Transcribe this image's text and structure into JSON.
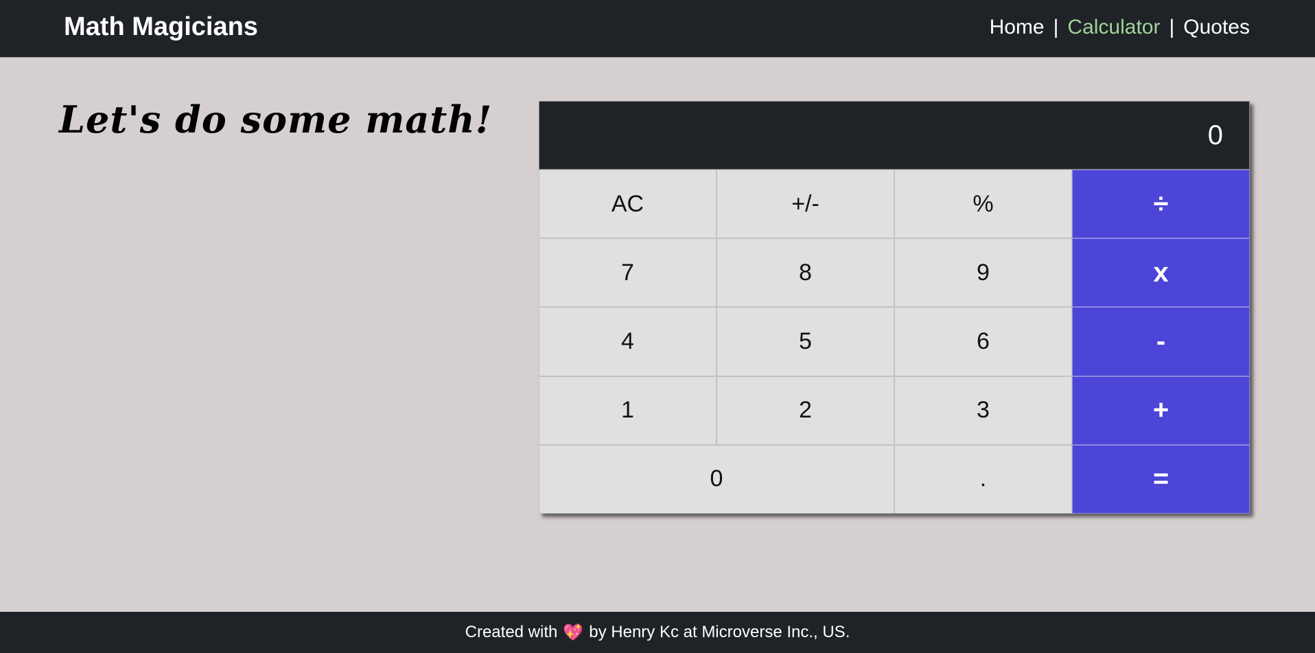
{
  "navbar": {
    "brand": "Math Magicians",
    "links": [
      {
        "label": "Home"
      },
      {
        "label": "Calculator"
      },
      {
        "label": "Quotes"
      }
    ],
    "separator": "|",
    "active_color": "#9fd49a"
  },
  "heading": "Let's do some math!",
  "calculator": {
    "display": "0",
    "keys": [
      {
        "label": "AC",
        "type": "function"
      },
      {
        "label": "+/-",
        "type": "function"
      },
      {
        "label": "%",
        "type": "function"
      },
      {
        "label": "÷",
        "type": "operator"
      },
      {
        "label": "7",
        "type": "digit"
      },
      {
        "label": "8",
        "type": "digit"
      },
      {
        "label": "9",
        "type": "digit"
      },
      {
        "label": "x",
        "type": "operator"
      },
      {
        "label": "4",
        "type": "digit"
      },
      {
        "label": "5",
        "type": "digit"
      },
      {
        "label": "6",
        "type": "digit"
      },
      {
        "label": "-",
        "type": "operator"
      },
      {
        "label": "1",
        "type": "digit"
      },
      {
        "label": "2",
        "type": "digit"
      },
      {
        "label": "3",
        "type": "digit"
      },
      {
        "label": "+",
        "type": "operator"
      },
      {
        "label": "0",
        "type": "digit"
      },
      {
        "label": ".",
        "type": "digit"
      },
      {
        "label": "=",
        "type": "operator"
      }
    ],
    "operator_color": "#4c45d7",
    "key_color": "#e0e0e0",
    "display_color": "#1f2226"
  },
  "footer": {
    "prefix": "Created with",
    "heart_icon": "sparkling-heart-icon",
    "heart_glyph": "💖",
    "suffix": "by Henry Kc at Microverse Inc., US."
  }
}
